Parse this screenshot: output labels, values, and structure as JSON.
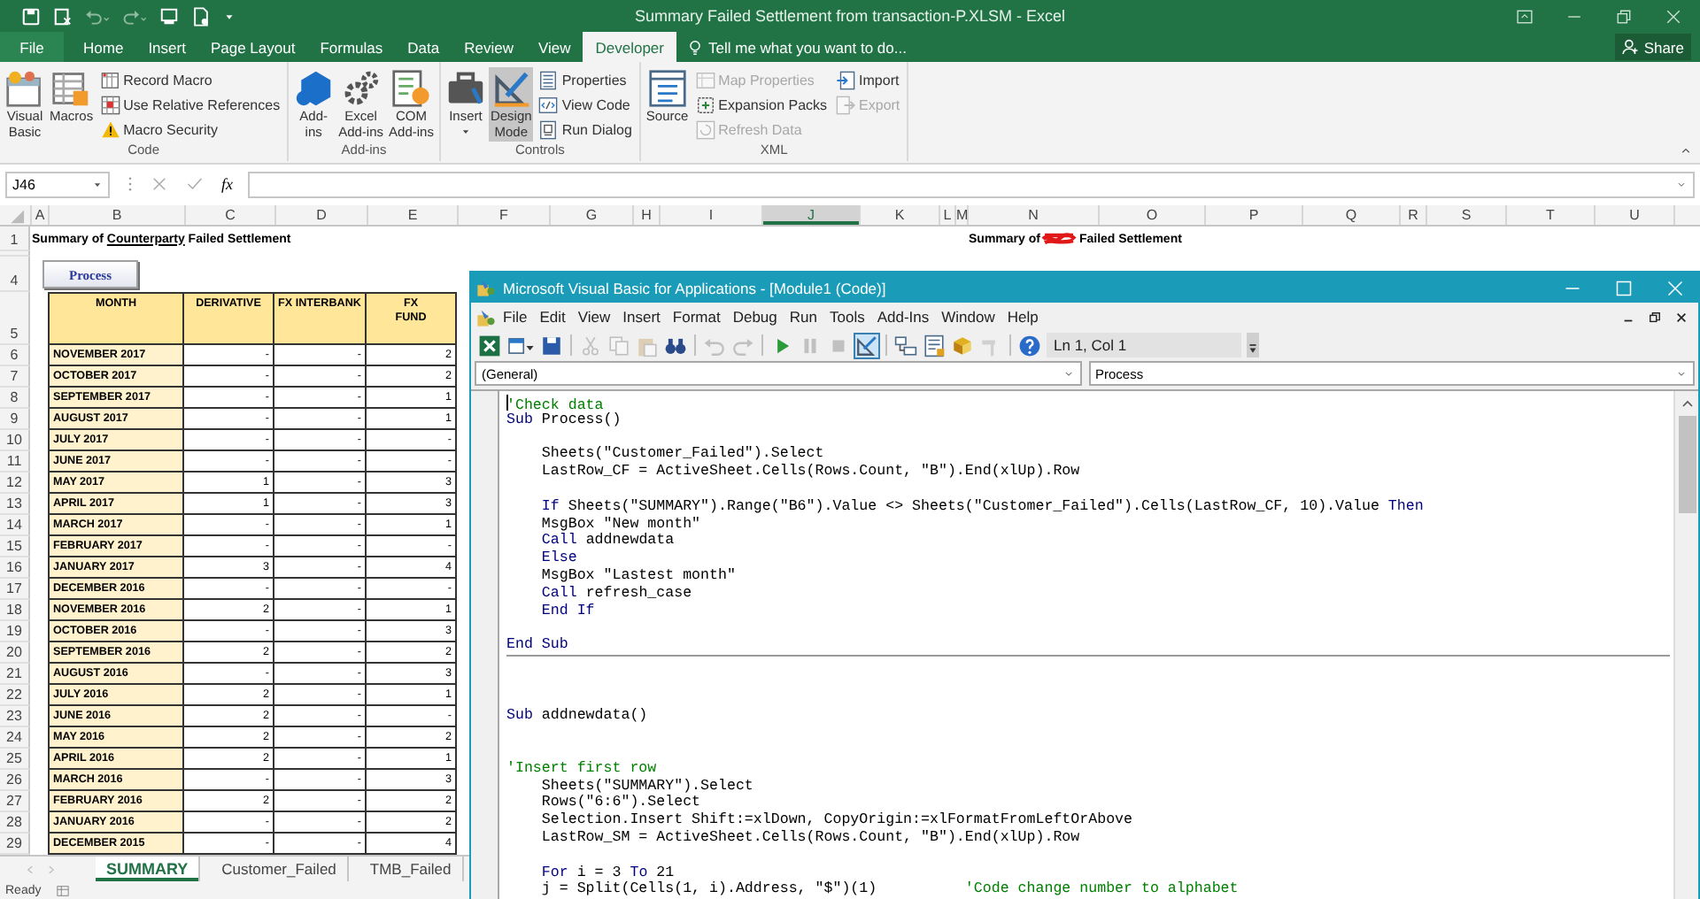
{
  "title_bar": {
    "title": "Summary Failed Settlement from transaction-P.XLSM - Excel"
  },
  "ribbon_tabs": [
    {
      "label": "File",
      "kind": "file",
      "selected": false
    },
    {
      "label": "Home",
      "kind": "tab",
      "selected": false
    },
    {
      "label": "Insert",
      "kind": "tab",
      "selected": false
    },
    {
      "label": "Page Layout",
      "kind": "tab",
      "selected": false
    },
    {
      "label": "Formulas",
      "kind": "tab",
      "selected": false
    },
    {
      "label": "Data",
      "kind": "tab",
      "selected": false
    },
    {
      "label": "Review",
      "kind": "tab",
      "selected": false
    },
    {
      "label": "View",
      "kind": "tab",
      "selected": false
    },
    {
      "label": "Developer",
      "kind": "tab",
      "selected": true
    }
  ],
  "tell_me": {
    "placeholder": "Tell me what you want to do..."
  },
  "share_button": "Share",
  "ribbon_groups": [
    {
      "label": "Code",
      "items": [
        {
          "kind": "large",
          "label": "Visual\nBasic",
          "selected": false
        },
        {
          "kind": "large",
          "label": "Macros",
          "selected": false
        },
        {
          "kind": "stack",
          "buttons": [
            {
              "label": "Record Macro",
              "disabled": false
            },
            {
              "label": "Use Relative References",
              "disabled": false
            },
            {
              "label": "Macro Security",
              "disabled": false
            }
          ]
        }
      ]
    },
    {
      "label": "Add-ins",
      "items": [
        {
          "kind": "large",
          "label": "Add-\nins",
          "selected": false
        },
        {
          "kind": "large",
          "label": "Excel\nAdd-ins",
          "selected": false
        },
        {
          "kind": "large",
          "label": "COM\nAdd-ins",
          "selected": false
        }
      ]
    },
    {
      "label": "Controls",
      "items": [
        {
          "kind": "dropdown",
          "label": "Insert",
          "selected": false
        },
        {
          "kind": "large",
          "label": "Design\nMode",
          "selected": true
        },
        {
          "kind": "stack",
          "buttons": [
            {
              "label": "Properties",
              "disabled": false
            },
            {
              "label": "View Code",
              "disabled": false
            },
            {
              "label": "Run Dialog",
              "disabled": false
            }
          ]
        }
      ]
    },
    {
      "label": "XML",
      "items": [
        {
          "kind": "large",
          "label": "Source",
          "selected": false
        },
        {
          "kind": "stack",
          "buttons": [
            {
              "label": "Map Properties",
              "disabled": true
            },
            {
              "label": "Expansion Packs",
              "disabled": false
            },
            {
              "label": "Refresh Data",
              "disabled": true
            }
          ]
        },
        {
          "kind": "stack",
          "buttons": [
            {
              "label": "Import",
              "disabled": false
            },
            {
              "label": "Export",
              "disabled": true
            }
          ]
        }
      ]
    }
  ],
  "formula_bar": {
    "name_box": "J46",
    "function_label": "fx"
  },
  "sheet": {
    "columns": [
      {
        "label": "A",
        "selected": false
      },
      {
        "label": "B",
        "selected": false
      },
      {
        "label": "C",
        "selected": false
      },
      {
        "label": "D",
        "selected": false
      },
      {
        "label": "E",
        "selected": false
      },
      {
        "label": "F",
        "selected": false
      },
      {
        "label": "G",
        "selected": false
      },
      {
        "label": "H",
        "selected": false
      },
      {
        "label": "I",
        "selected": false
      },
      {
        "label": "J",
        "selected": true
      },
      {
        "label": "K",
        "selected": false
      },
      {
        "label": "L",
        "selected": false
      },
      {
        "label": "M",
        "selected": false
      },
      {
        "label": "N",
        "selected": false
      },
      {
        "label": "O",
        "selected": false
      },
      {
        "label": "P",
        "selected": false
      },
      {
        "label": "Q",
        "selected": false
      },
      {
        "label": "R",
        "selected": false
      },
      {
        "label": "S",
        "selected": false
      },
      {
        "label": "T",
        "selected": false
      },
      {
        "label": "U",
        "selected": false
      }
    ],
    "title_row": {
      "row": "1",
      "left_title": [
        {
          "text": "Summary of ",
          "underline": false
        },
        {
          "text": "Counterparty",
          "underline": true
        },
        {
          "text": " Failed Settlement",
          "underline": false
        }
      ],
      "right_title_start": "Summary of",
      "right_title_end": "Failed Settlement"
    },
    "button_row": {
      "row": "4",
      "button": "Process"
    },
    "table": {
      "header_row": "5",
      "columns": [
        "MONTH",
        "DERIVATIVE",
        "FX INTERBANK",
        "FX\nFUND"
      ],
      "rows": [
        {
          "row": "6",
          "cells": [
            "NOVEMBER 2017",
            "-",
            "-",
            "2"
          ]
        },
        {
          "row": "7",
          "cells": [
            "OCTOBER 2017",
            "-",
            "-",
            "2"
          ]
        },
        {
          "row": "8",
          "cells": [
            "SEPTEMBER 2017",
            "-",
            "-",
            "1"
          ]
        },
        {
          "row": "9",
          "cells": [
            "AUGUST 2017",
            "-",
            "-",
            "1"
          ]
        },
        {
          "row": "10",
          "cells": [
            "JULY 2017",
            "-",
            "-",
            "-"
          ]
        },
        {
          "row": "11",
          "cells": [
            "JUNE 2017",
            "-",
            "-",
            "-"
          ]
        },
        {
          "row": "12",
          "cells": [
            "MAY 2017",
            "1",
            "-",
            "3"
          ]
        },
        {
          "row": "13",
          "cells": [
            "APRIL 2017",
            "1",
            "-",
            "3"
          ]
        },
        {
          "row": "14",
          "cells": [
            "MARCH 2017",
            "-",
            "-",
            "1"
          ]
        },
        {
          "row": "15",
          "cells": [
            "FEBRUARY 2017",
            "-",
            "-",
            "-"
          ]
        },
        {
          "row": "16",
          "cells": [
            "JANUARY 2017",
            "3",
            "-",
            "4"
          ]
        },
        {
          "row": "17",
          "cells": [
            "DECEMBER 2016",
            "-",
            "-",
            "-"
          ]
        },
        {
          "row": "18",
          "cells": [
            "NOVEMBER 2016",
            "2",
            "-",
            "1"
          ]
        },
        {
          "row": "19",
          "cells": [
            "OCTOBER 2016",
            "-",
            "-",
            "3"
          ]
        },
        {
          "row": "20",
          "cells": [
            "SEPTEMBER 2016",
            "2",
            "-",
            "2"
          ]
        },
        {
          "row": "21",
          "cells": [
            "AUGUST 2016",
            "-",
            "-",
            "3"
          ]
        },
        {
          "row": "22",
          "cells": [
            "JULY 2016",
            "2",
            "-",
            "1"
          ]
        },
        {
          "row": "23",
          "cells": [
            "JUNE 2016",
            "2",
            "-",
            "-"
          ]
        },
        {
          "row": "24",
          "cells": [
            "MAY 2016",
            "2",
            "-",
            "2"
          ]
        },
        {
          "row": "25",
          "cells": [
            "APRIL 2016",
            "2",
            "-",
            "1"
          ]
        },
        {
          "row": "26",
          "cells": [
            "MARCH 2016",
            "-",
            "-",
            "3"
          ]
        },
        {
          "row": "27",
          "cells": [
            "FEBRUARY 2016",
            "2",
            "-",
            "2"
          ]
        },
        {
          "row": "28",
          "cells": [
            "JANUARY 2016",
            "-",
            "-",
            "2"
          ]
        },
        {
          "row": "29",
          "cells": [
            "DECEMBER 2015",
            "-",
            "-",
            "4"
          ]
        }
      ]
    },
    "sheet_tabs": [
      {
        "label": "SUMMARY",
        "selected": true
      },
      {
        "label": "Customer_Failed",
        "selected": false
      },
      {
        "label": "TMB_Failed",
        "selected": false
      }
    ],
    "status": "Ready"
  },
  "vba": {
    "title": "Microsoft Visual Basic for Applications - [Module1 (Code)]",
    "menu": [
      "File",
      "Edit",
      "View",
      "Insert",
      "Format",
      "Debug",
      "Run",
      "Tools",
      "Add-Ins",
      "Window",
      "Help"
    ],
    "toolbar": [
      {
        "selected": false,
        "disabled": false
      },
      {
        "selected": false,
        "disabled": false
      },
      {
        "selected": false,
        "disabled": false
      },
      {
        "selected": false,
        "disabled": true
      },
      {
        "selected": false,
        "disabled": true
      },
      {
        "selected": false,
        "disabled": true
      },
      {
        "selected": false,
        "disabled": false
      },
      {
        "selected": false,
        "disabled": true
      },
      {
        "selected": false,
        "disabled": true
      },
      {
        "selected": false,
        "disabled": false
      },
      {
        "selected": false,
        "disabled": true
      },
      {
        "selected": false,
        "disabled": true
      },
      {
        "selected": true,
        "disabled": false
      },
      {
        "selected": false,
        "disabled": false
      },
      {
        "selected": false,
        "disabled": false
      },
      {
        "selected": false,
        "disabled": false
      },
      {
        "selected": false,
        "disabled": true
      },
      {
        "selected": false,
        "disabled": false
      }
    ],
    "position": "Ln 1, Col 1",
    "object_box": "(General)",
    "procedure_box": "Process",
    "procedures": [
      {
        "lines": [
          {
            "kind": "code",
            "tokens": [
              {
                "kind": "comment",
                "text": "'Check data"
              }
            ]
          },
          {
            "kind": "code",
            "tokens": [
              {
                "kind": "keyword",
                "text": "Sub"
              },
              {
                "kind": "plain",
                "text": " Process()"
              }
            ]
          },
          {
            "kind": "blank"
          },
          {
            "kind": "code",
            "tokens": [
              {
                "kind": "plain",
                "text": "    Sheets(\"Customer_Failed\").Select"
              }
            ]
          },
          {
            "kind": "code",
            "tokens": [
              {
                "kind": "plain",
                "text": "    LastRow_CF = ActiveSheet.Cells(Rows.Count, \"B\").End(xlUp).Row"
              }
            ]
          },
          {
            "kind": "blank"
          },
          {
            "kind": "code",
            "tokens": [
              {
                "kind": "keyword",
                "text": "    If"
              },
              {
                "kind": "plain",
                "text": " Sheets(\"SUMMARY\").Range(\"B6\").Value <> Sheets(\"Customer_Failed\").Cells(LastRow_CF, 10).Value "
              },
              {
                "kind": "keyword",
                "text": "Then"
              }
            ]
          },
          {
            "kind": "code",
            "tokens": [
              {
                "kind": "plain",
                "text": "    MsgBox \"New month\""
              }
            ]
          },
          {
            "kind": "code",
            "tokens": [
              {
                "kind": "keyword",
                "text": "    Call"
              },
              {
                "kind": "plain",
                "text": " addnewdata"
              }
            ]
          },
          {
            "kind": "code",
            "tokens": [
              {
                "kind": "keyword",
                "text": "    Else"
              }
            ]
          },
          {
            "kind": "code",
            "tokens": [
              {
                "kind": "plain",
                "text": "    MsgBox \"Lastest month\""
              }
            ]
          },
          {
            "kind": "code",
            "tokens": [
              {
                "kind": "keyword",
                "text": "    Call"
              },
              {
                "kind": "plain",
                "text": " refresh_case"
              }
            ]
          },
          {
            "kind": "code",
            "tokens": [
              {
                "kind": "keyword",
                "text": "    End If"
              }
            ]
          },
          {
            "kind": "blank"
          },
          {
            "kind": "code",
            "tokens": [
              {
                "kind": "keyword",
                "text": "End Sub"
              }
            ]
          }
        ]
      },
      {
        "lines": [
          {
            "kind": "blank"
          },
          {
            "kind": "blank"
          },
          {
            "kind": "blank"
          },
          {
            "kind": "code",
            "tokens": [
              {
                "kind": "keyword",
                "text": "Sub"
              },
              {
                "kind": "plain",
                "text": " addnewdata()"
              }
            ]
          },
          {
            "kind": "blank"
          },
          {
            "kind": "blank"
          },
          {
            "kind": "code",
            "tokens": [
              {
                "kind": "comment",
                "text": "'Insert first row"
              }
            ]
          },
          {
            "kind": "code",
            "tokens": [
              {
                "kind": "plain",
                "text": "    Sheets(\"SUMMARY\").Select"
              }
            ]
          },
          {
            "kind": "code",
            "tokens": [
              {
                "kind": "plain",
                "text": "    Rows(\"6:6\").Select"
              }
            ]
          },
          {
            "kind": "code",
            "tokens": [
              {
                "kind": "plain",
                "text": "    Selection.Insert Shift:=xlDown, CopyOrigin:=xlFormatFromLeftOrAbove"
              }
            ]
          },
          {
            "kind": "code",
            "tokens": [
              {
                "kind": "plain",
                "text": "    LastRow_SM = ActiveSheet.Cells(Rows.Count, \"B\").End(xlUp).Row"
              }
            ]
          },
          {
            "kind": "blank"
          },
          {
            "kind": "code",
            "tokens": [
              {
                "kind": "keyword",
                "text": "    For"
              },
              {
                "kind": "plain",
                "text": " i = 3 "
              },
              {
                "kind": "keyword",
                "text": "To"
              },
              {
                "kind": "plain",
                "text": " 21"
              }
            ]
          },
          {
            "kind": "code",
            "tokens": [
              {
                "kind": "plain",
                "text": "    j = Split(Cells(1, i).Address, \"$\")(1)          "
              },
              {
                "kind": "comment",
                "text": "'Code change number to alphabet"
              }
            ]
          }
        ]
      }
    ]
  }
}
